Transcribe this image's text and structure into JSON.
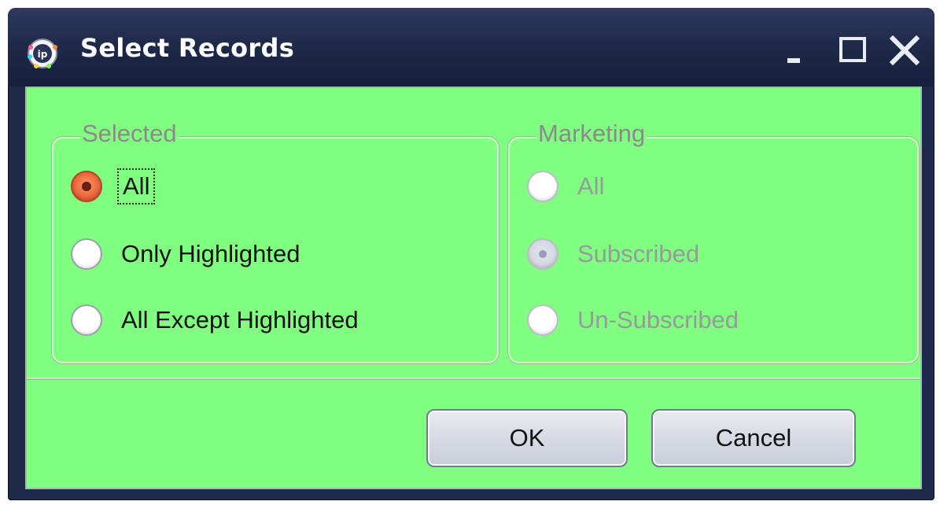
{
  "window": {
    "title": "Select Records",
    "controls": [
      "minimize",
      "maximize",
      "close"
    ],
    "icon": "app-logo-icon"
  },
  "colors": {
    "client_background": "#80ff80",
    "titlebar": "#1f2a4a",
    "selected_radio": "#e8643a",
    "disabled_text": "#959a9a"
  },
  "selected_group": {
    "legend": "Selected",
    "options": [
      {
        "label": "All",
        "checked": true,
        "focused": true
      },
      {
        "label": "Only Highlighted",
        "checked": false
      },
      {
        "label": "All Except Highlighted",
        "checked": false
      }
    ]
  },
  "marketing_group": {
    "legend": "Marketing",
    "disabled": true,
    "options": [
      {
        "label": "All",
        "checked": false
      },
      {
        "label": "Subscribed",
        "checked": true
      },
      {
        "label": "Un-Subscribed",
        "checked": false
      }
    ]
  },
  "buttons": {
    "ok": "OK",
    "cancel": "Cancel"
  }
}
